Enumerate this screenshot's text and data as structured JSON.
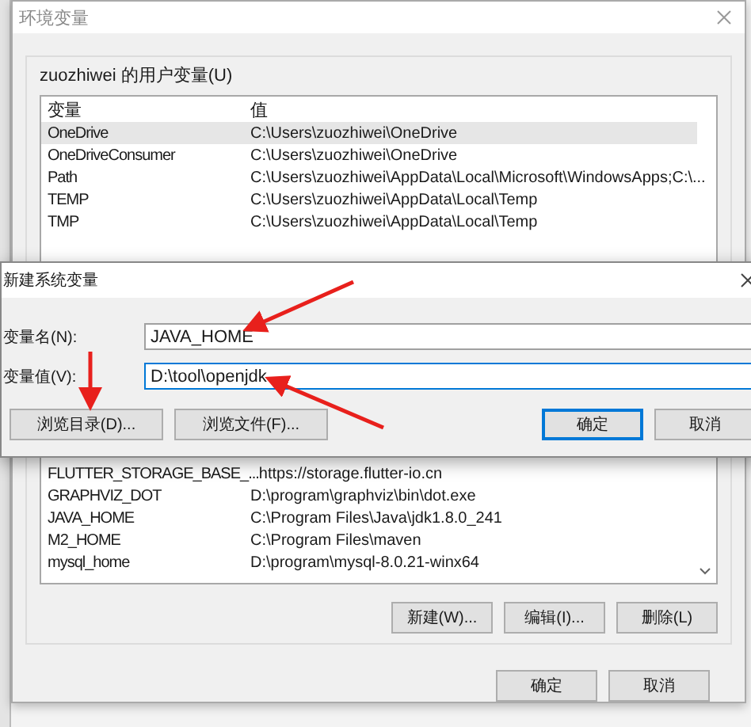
{
  "window": {
    "title": "环境变量"
  },
  "user_variables": {
    "label": "zuozhiwei 的用户变量(U)",
    "columns": [
      "变量",
      "值"
    ],
    "rows": [
      {
        "name": "OneDrive",
        "value": "C:\\Users\\zuozhiwei\\OneDrive",
        "selected": true
      },
      {
        "name": "OneDriveConsumer",
        "value": "C:\\Users\\zuozhiwei\\OneDrive",
        "selected": false
      },
      {
        "name": "Path",
        "value": "C:\\Users\\zuozhiwei\\AppData\\Local\\Microsoft\\WindowsApps;C:\\...",
        "selected": false
      },
      {
        "name": "TEMP",
        "value": "C:\\Users\\zuozhiwei\\AppData\\Local\\Temp",
        "selected": false
      },
      {
        "name": "TMP",
        "value": "C:\\Users\\zuozhiwei\\AppData\\Local\\Temp",
        "selected": false
      }
    ]
  },
  "system_variables": {
    "rows": [
      {
        "name": "FLUTTER_STORAGE_BASE_...",
        "value": "https://storage.flutter-io.cn",
        "selected": false
      },
      {
        "name": "GRAPHVIZ_DOT",
        "value": "D:\\program\\graphviz\\bin\\dot.exe",
        "selected": false
      },
      {
        "name": "JAVA_HOME",
        "value": "C:\\Program Files\\Java\\jdk1.8.0_241",
        "selected": false
      },
      {
        "name": "M2_HOME",
        "value": "C:\\Program Files\\maven",
        "selected": false
      },
      {
        "name": "mysql_home",
        "value": "D:\\program\\mysql-8.0.21-winx64",
        "selected": false
      }
    ],
    "buttons": [
      "新建(W)...",
      "编辑(I)...",
      "删除(L)"
    ]
  },
  "buttons": [
    "确定",
    "取消"
  ],
  "dialog": {
    "title": "新建系统变量",
    "fields": [
      {
        "label": "变量名(N):",
        "value": "JAVA_HOME",
        "focused": false
      },
      {
        "label": "变量值(V):",
        "value": "D:\\tool\\openjdk",
        "focused": true
      }
    ],
    "buttons": [
      {
        "label": "浏览目录(D)...",
        "kind": "normal"
      },
      {
        "label": "浏览文件(F)...",
        "kind": "normal"
      },
      {
        "label": "确定",
        "kind": "default"
      },
      {
        "label": "取消",
        "kind": "normal"
      }
    ]
  }
}
